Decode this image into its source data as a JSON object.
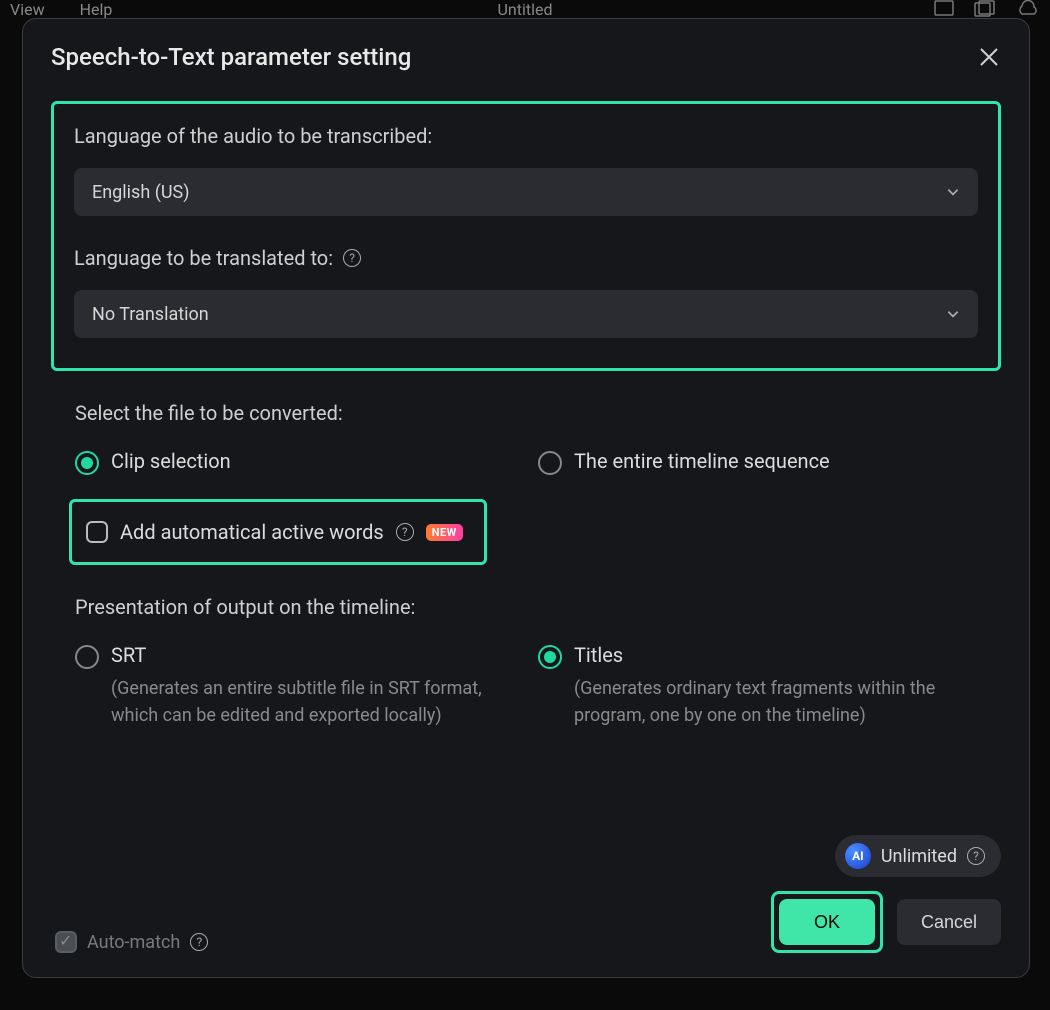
{
  "background": {
    "menu_view": "View",
    "menu_help": "Help",
    "title": "Untitled"
  },
  "dialog": {
    "title": "Speech-to-Text parameter setting",
    "language_section": {
      "label_source": "Language of the audio to be transcribed:",
      "source_value": "English (US)",
      "label_target": "Language to be translated to:",
      "target_value": "No Translation"
    },
    "file_section": {
      "label": "Select the file to be converted:",
      "option_clip": "Clip selection",
      "option_timeline": "The entire timeline sequence"
    },
    "active_words": {
      "label": "Add automatical active words",
      "badge": "NEW"
    },
    "output_section": {
      "label": "Presentation of output on the timeline:",
      "srt_label": "SRT",
      "srt_desc": "(Generates an entire subtitle file in SRT format, which can be edited and exported locally)",
      "titles_label": "Titles",
      "titles_desc": "(Generates ordinary text fragments within the program, one by one on the timeline)"
    },
    "footer": {
      "auto_match": "Auto-match",
      "ai_label": "AI",
      "unlimited": "Unlimited",
      "ok": "OK",
      "cancel": "Cancel"
    }
  }
}
